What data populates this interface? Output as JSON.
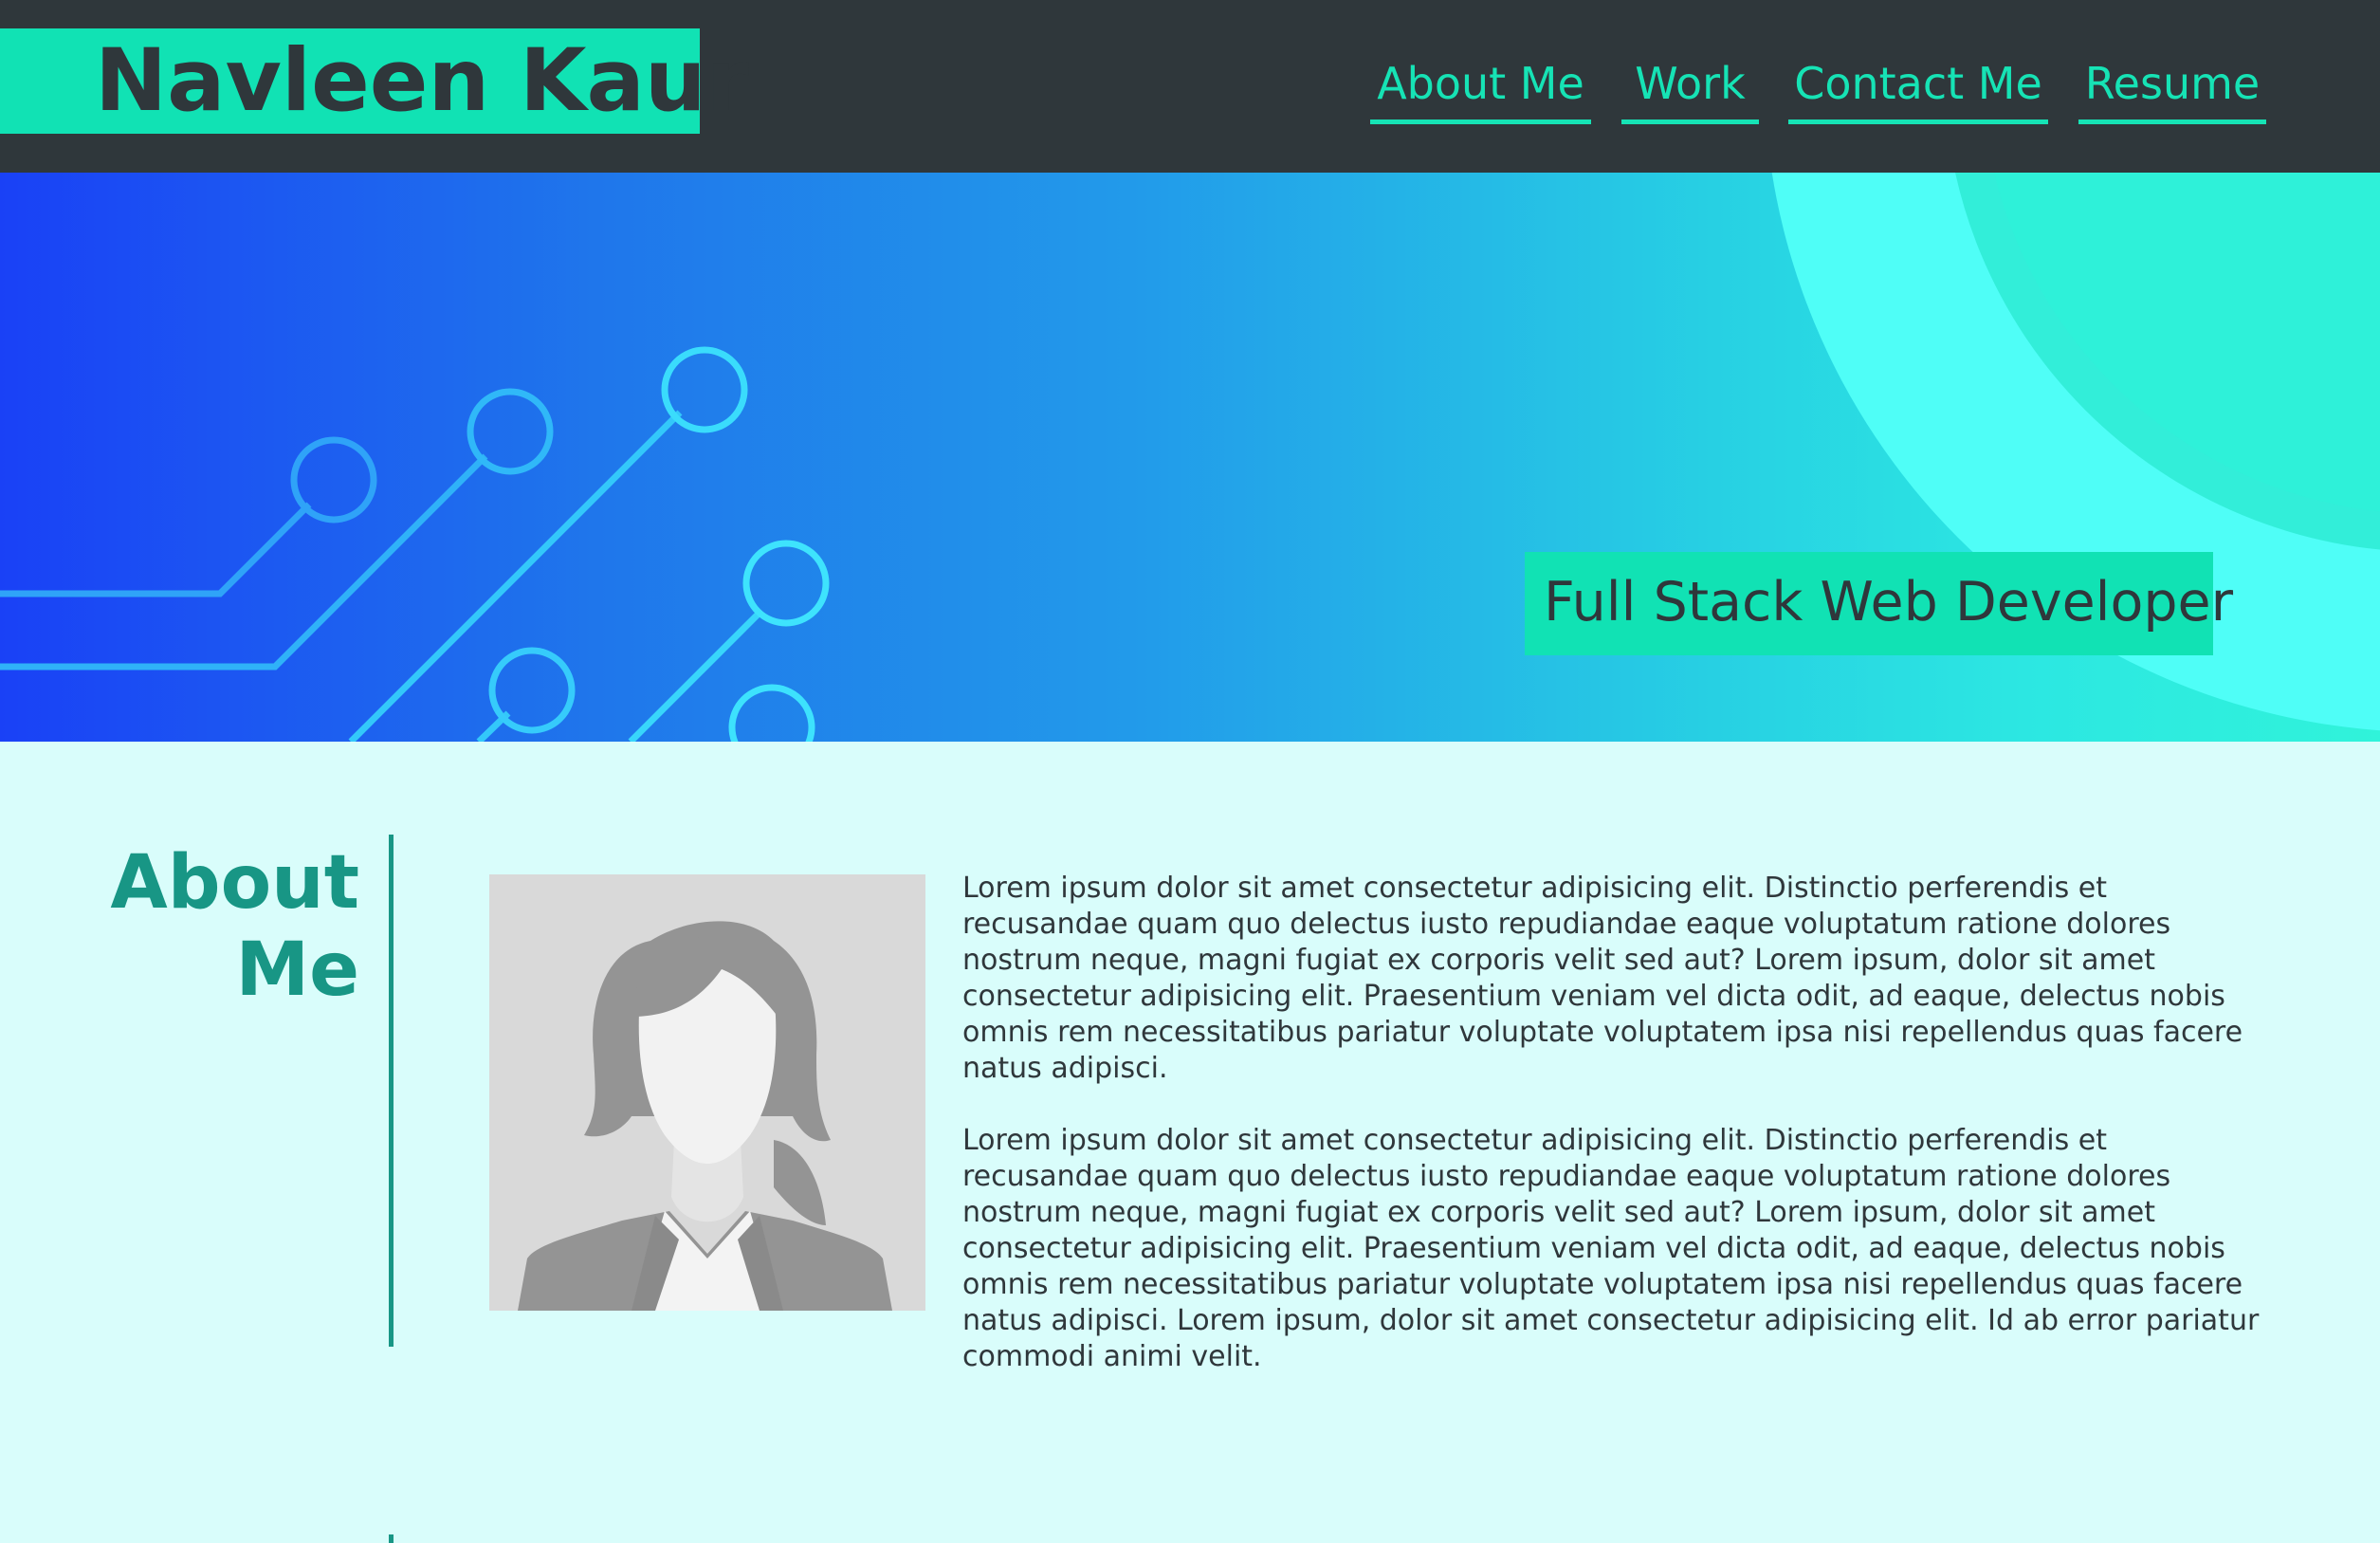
{
  "header": {
    "brand": "Navleen Kaur",
    "nav": [
      {
        "label": "About Me"
      },
      {
        "label": "Work"
      },
      {
        "label": "Contact Me"
      },
      {
        "label": "Resume"
      }
    ]
  },
  "hero": {
    "tagline": "Full Stack Web Developer"
  },
  "about": {
    "title_line1": "About",
    "title_line2": "Me",
    "paragraphs": [
      "Lorem ipsum dolor sit amet consectetur adipisicing elit. Distinctio perferendis et recusandae quam quo delectus iusto repudiandae eaque voluptatum ratione dolores nostrum neque, magni fugiat ex corporis velit sed aut? Lorem ipsum, dolor sit amet consectetur adipisicing elit. Praesentium veniam vel dicta odit, ad eaque, delectus nobis omnis rem necessitatibus pariatur voluptate voluptatem ipsa nisi repellendus quas facere natus adipisci.",
      "Lorem ipsum dolor sit amet consectetur adipisicing elit. Distinctio perferendis et recusandae quam quo delectus iusto repudiandae eaque voluptatum ratione dolores nostrum neque, magni fugiat ex corporis velit sed aut? Lorem ipsum, dolor sit amet consectetur adipisicing elit. Praesentium veniam vel dicta odit, ad eaque, delectus nobis omnis rem necessitatibus pariatur voluptate voluptatem ipsa nisi repellendus quas facere natus adipisci. Lorem ipsum, dolor sit amet consectetur adipisicing elit. Id ab error pariatur commodi animi velit."
    ]
  },
  "colors": {
    "header_bg": "#2f373b",
    "accent": "#11e2b4",
    "heading": "#189685",
    "section_bg": "#d9fdfb"
  },
  "icons": {
    "avatar": "person-placeholder-icon",
    "hero_decoration": "circuit-lines-icon"
  }
}
